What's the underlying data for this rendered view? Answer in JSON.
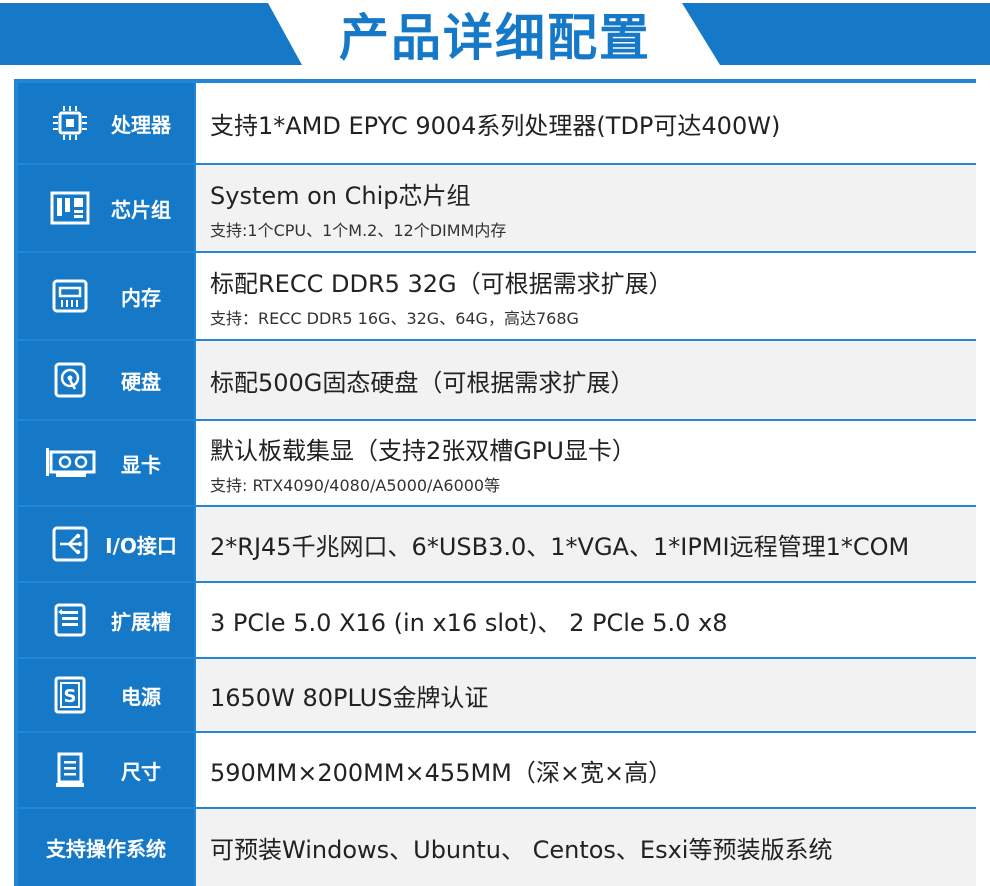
{
  "header": {
    "title": "产品详细配置"
  },
  "colors": {
    "blue": "#1679c7",
    "light_blue": "#1f86d8",
    "row_gray": "#f2f2f2",
    "text": "#222222"
  },
  "rows": [
    {
      "icon": "cpu-icon",
      "label": "处理器",
      "main": "支持1*AMD EPYC 9004系列处理器(TDP可达400W)",
      "sub": ""
    },
    {
      "icon": "chipset-icon",
      "label": "芯片组",
      "main": "System on Chip芯片组",
      "sub": "支持:1个CPU、1个M.2、12个DIMM内存"
    },
    {
      "icon": "memory-icon",
      "label": "内存",
      "main": "标配RECC DDR5 32G（可根据需求扩展）",
      "sub": "支持：RECC DDR5 16G、32G、64G，高达768G"
    },
    {
      "icon": "hard-disk-icon",
      "label": "硬盘",
      "main": "标配500G固态硬盘（可根据需求扩展）",
      "sub": ""
    },
    {
      "icon": "graphics-card-icon",
      "label": "显卡",
      "main": "默认板载集显（支持2张双槽GPU显卡）",
      "sub": "支持: RTX4090/4080/A5000/A6000等"
    },
    {
      "icon": "usb-ports-icon",
      "label": "I/O接口",
      "main": "2*RJ45千兆网口、6*USB3.0、1*VGA、1*IPMI远程管理1*COM",
      "sub": ""
    },
    {
      "icon": "expansion-slot-icon",
      "label": "扩展槽",
      "main": "3 PCle 5.0 X16 (in x16 slot)、 2 PCle 5.0 x8",
      "sub": ""
    },
    {
      "icon": "power-supply-icon",
      "label": "电源",
      "main": "1650W 80PLUS金牌认证",
      "sub": ""
    },
    {
      "icon": "chassis-size-icon",
      "label": "尺寸",
      "main": "590MM×200MM×455MM（深×宽×高）",
      "sub": ""
    },
    {
      "icon": "",
      "label": "支持操作系统",
      "main": "可预装Windows、Ubuntu、 Centos、Esxi等预装版系统",
      "sub": ""
    }
  ]
}
